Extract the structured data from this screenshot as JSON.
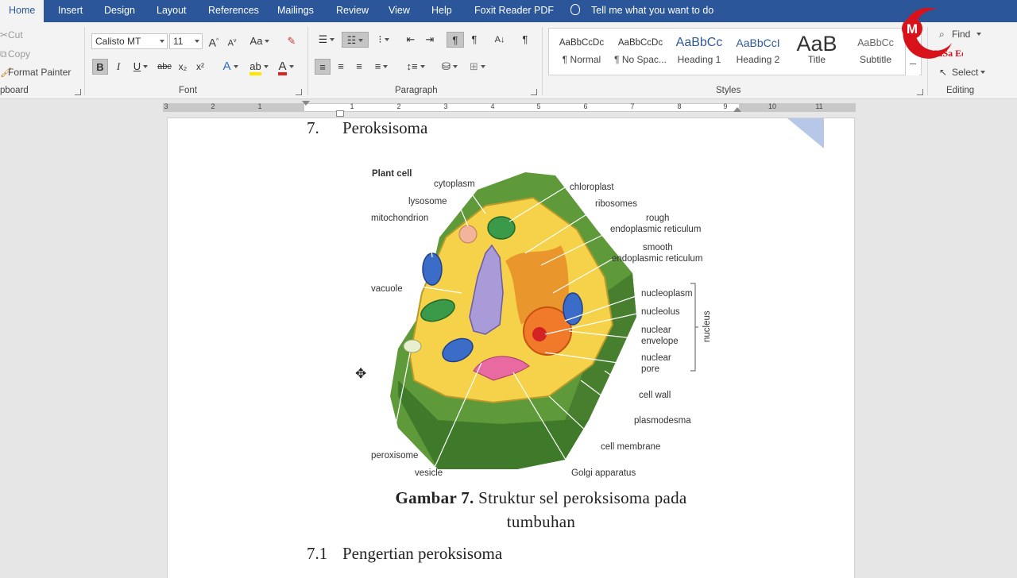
{
  "tabs": {
    "home": "Home",
    "insert": "Insert",
    "design": "Design",
    "layout": "Layout",
    "references": "References",
    "mailings": "Mailings",
    "review": "Review",
    "view": "View",
    "help": "Help",
    "foxit": "Foxit Reader PDF",
    "tell_me": "Tell me what you want to do"
  },
  "clipboard": {
    "cut": "Cut",
    "copy": "Copy",
    "format_painter": "Format Painter",
    "label": "pboard"
  },
  "font": {
    "family": "Calisto MT",
    "size": "11",
    "case": "Aa",
    "label": "Font",
    "bold": "B",
    "italic": "I",
    "underline": "U",
    "strike": "abc",
    "subscript": "x₂",
    "superscript": "x²",
    "text_effects": "A",
    "font_color": "A",
    "grow": "A",
    "shrink": "A"
  },
  "paragraph": {
    "label": "Paragraph",
    "pilcrow": "¶"
  },
  "styles": {
    "label": "Styles",
    "items": [
      {
        "preview": "AaBbCcDc",
        "name": "¶ Normal"
      },
      {
        "preview": "AaBbCcDc",
        "name": "¶ No Spac..."
      },
      {
        "preview": "AaBbCc",
        "name": "Heading 1"
      },
      {
        "preview": "AaBbCcI",
        "name": "Heading 2"
      },
      {
        "preview": "AaB",
        "name": "Title"
      },
      {
        "preview": "AaBbCc",
        "name": "Subtitle"
      }
    ]
  },
  "editing": {
    "find": "Find",
    "select": "Select",
    "label": "Editing"
  },
  "ruler": {
    "numbers": [
      "3",
      "2",
      "1",
      "1",
      "2",
      "3",
      "4",
      "5",
      "6",
      "7",
      "8",
      "9",
      "10",
      "11"
    ]
  },
  "document": {
    "heading_number": "7.",
    "heading_text": "Peroksisoma",
    "caption_bold": "Gambar 7.",
    "caption_rest": "Struktur sel peroksisoma pada tumbuhan",
    "subheading_number": "7.1",
    "subheading_text": "Pengertian peroksisoma"
  },
  "figure": {
    "title": "Plant cell",
    "labels": {
      "cytoplasm": "cytoplasm",
      "lysosome": "lysosome",
      "mitochondrion": "mitochondrion",
      "vacuole": "vacuole",
      "chloroplast": "chloroplast",
      "ribosomes": "ribosomes",
      "rough_er_1": "rough",
      "rough_er_2": "endoplasmic reticulum",
      "smooth_er_1": "smooth",
      "smooth_er_2": "endoplasmic reticulum",
      "nucleoplasm": "nucleoplasm",
      "nucleolus": "nucleolus",
      "nuclear_envelope_1": "nuclear",
      "nuclear_envelope_2": "envelope",
      "nuclear_pore_1": "nuclear",
      "nuclear_pore_2": "pore",
      "nucleus": "nucleus",
      "cell_wall": "cell wall",
      "plasmodesma": "plasmodesma",
      "cell_membrane": "cell membrane",
      "golgi": "Golgi apparatus",
      "vesicle": "vesicle",
      "peroxisome": "peroxisome"
    }
  },
  "logo": {
    "text": "MuSa Edu"
  }
}
